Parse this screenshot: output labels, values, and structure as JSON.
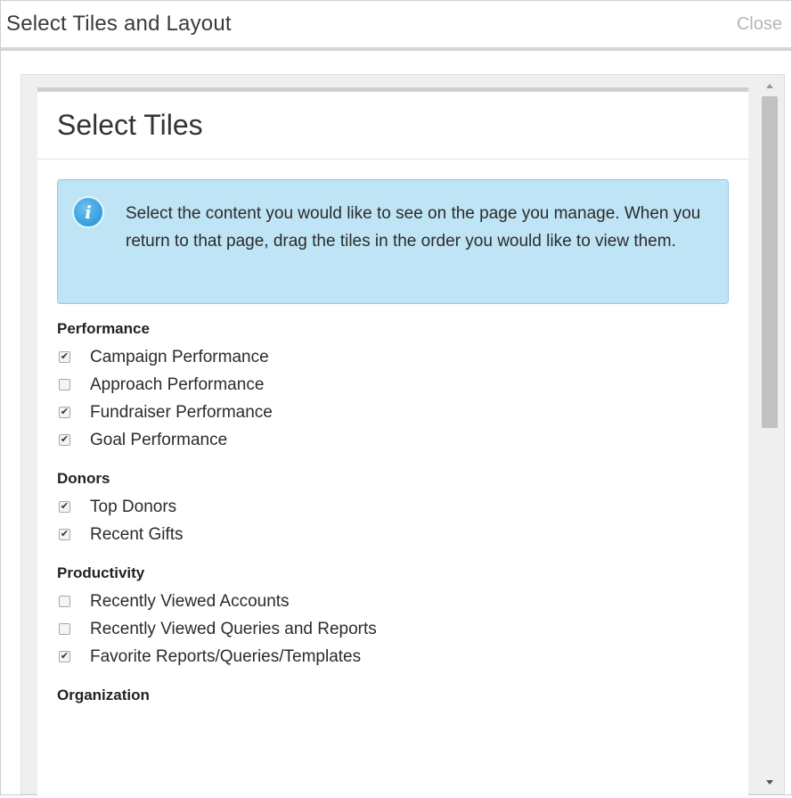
{
  "dialog": {
    "title": "Select Tiles and Layout",
    "close_label": "Close"
  },
  "panel": {
    "title": "Select Tiles",
    "info_text": "Select the content you would like to see on the page you manage. When you return to that page, drag the tiles in the order you would like to view them.",
    "info_icon": "info-icon"
  },
  "groups": [
    {
      "heading": "Performance",
      "options": [
        {
          "label": "Campaign Performance",
          "checked": true
        },
        {
          "label": "Approach Performance",
          "checked": false
        },
        {
          "label": "Fundraiser Performance",
          "checked": true
        },
        {
          "label": "Goal Performance",
          "checked": true
        }
      ]
    },
    {
      "heading": "Donors",
      "options": [
        {
          "label": "Top Donors",
          "checked": true
        },
        {
          "label": "Recent Gifts",
          "checked": true
        }
      ]
    },
    {
      "heading": "Productivity",
      "options": [
        {
          "label": "Recently Viewed Accounts",
          "checked": false
        },
        {
          "label": "Recently Viewed Queries and Reports",
          "checked": false
        },
        {
          "label": "Favorite Reports/Queries/Templates",
          "checked": true
        }
      ]
    },
    {
      "heading": "Organization",
      "options": []
    }
  ],
  "colors": {
    "info_bg": "#bfe4f5",
    "info_border": "#93c9e4",
    "close_text": "#b6b6b6"
  }
}
